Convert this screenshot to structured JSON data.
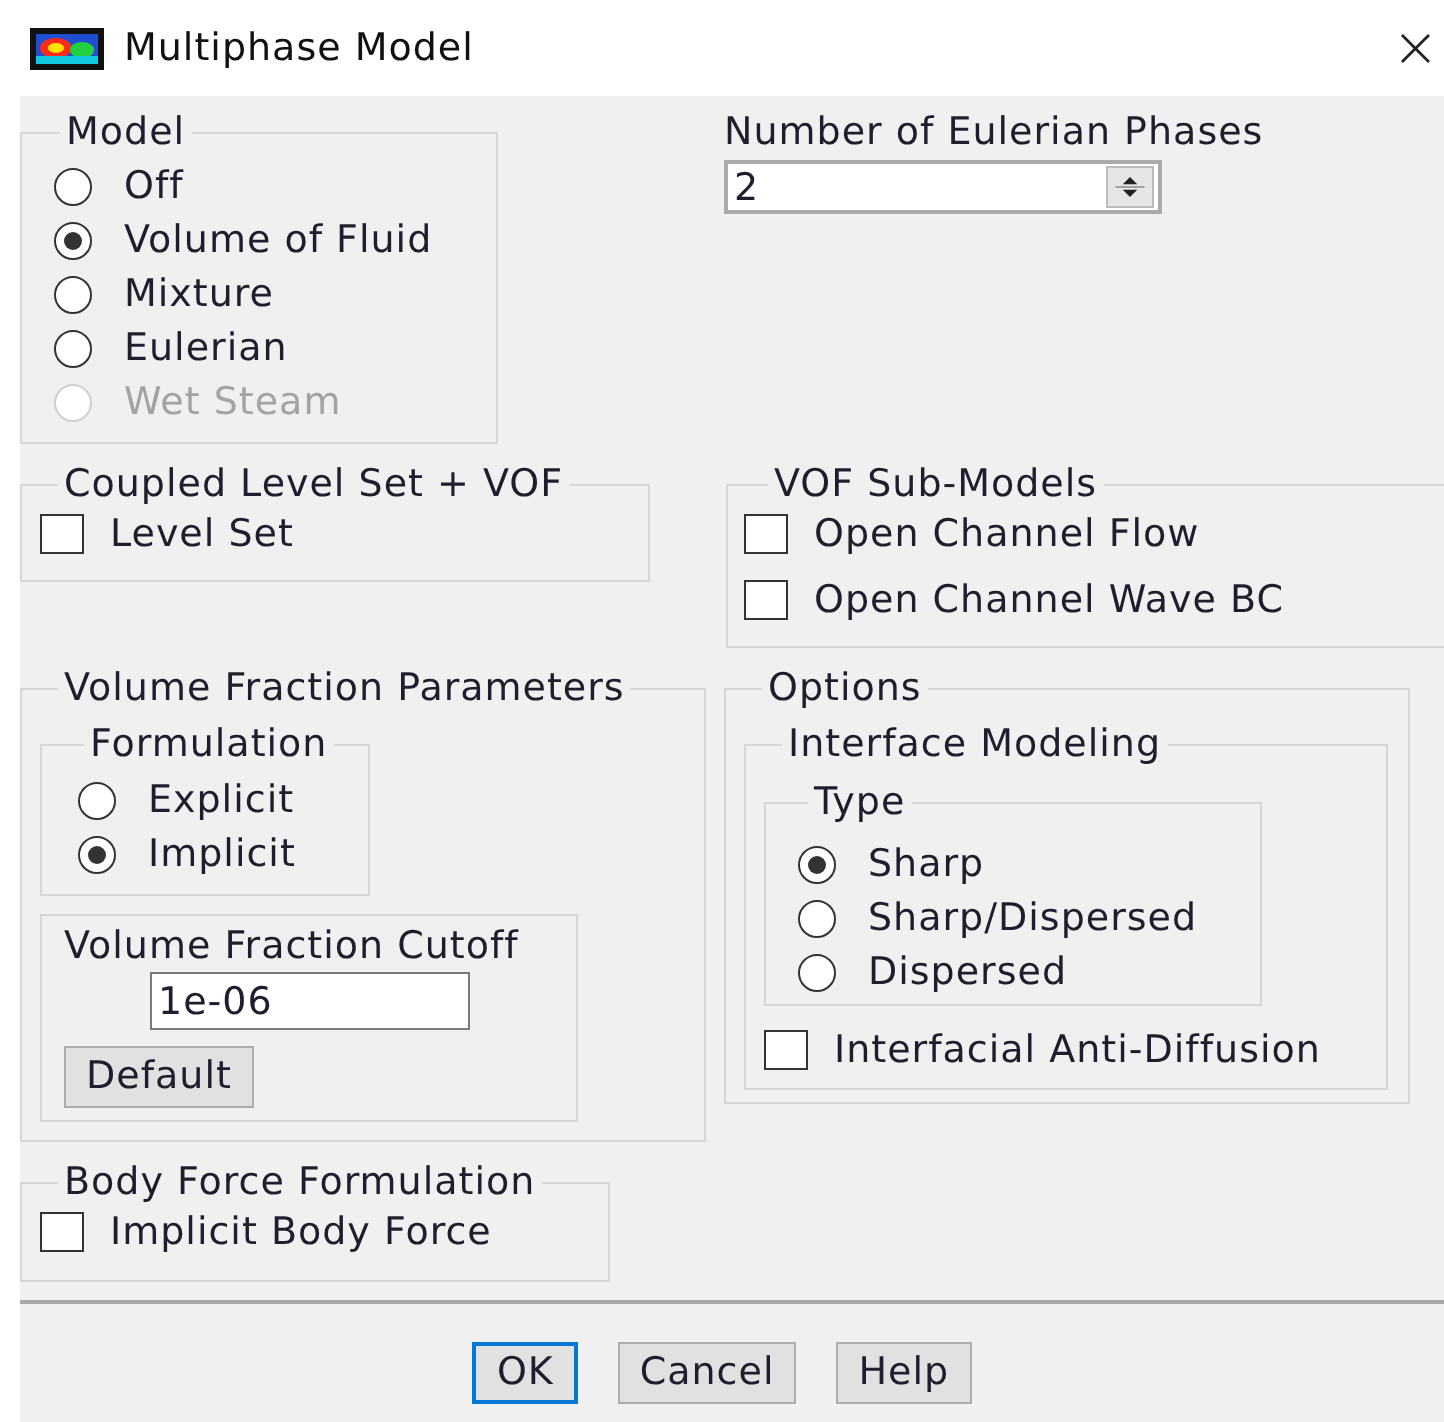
{
  "window": {
    "title": "Multiphase Model",
    "close": "×"
  },
  "model": {
    "label": "Model",
    "options": [
      {
        "label": "Off",
        "selected": false,
        "disabled": false
      },
      {
        "label": "Volume of Fluid",
        "selected": true,
        "disabled": false
      },
      {
        "label": "Mixture",
        "selected": false,
        "disabled": false
      },
      {
        "label": "Eulerian",
        "selected": false,
        "disabled": false
      },
      {
        "label": "Wet Steam",
        "selected": false,
        "disabled": true
      }
    ]
  },
  "eulerian_phases": {
    "label": "Number of Eulerian Phases",
    "value": "2"
  },
  "coupled_level_set": {
    "label": "Coupled Level Set + VOF",
    "options": [
      {
        "label": "Level Set",
        "checked": false
      }
    ]
  },
  "vof_sub_models": {
    "label": "VOF Sub-Models",
    "options": [
      {
        "label": "Open Channel Flow",
        "checked": false
      },
      {
        "label": "Open Channel Wave BC",
        "checked": false
      }
    ]
  },
  "volume_fraction_parameters": {
    "label": "Volume Fraction Parameters",
    "formulation": {
      "label": "Formulation",
      "options": [
        {
          "label": "Explicit",
          "selected": false
        },
        {
          "label": "Implicit",
          "selected": true
        }
      ]
    },
    "cutoff": {
      "label": "Volume Fraction Cutoff",
      "value": "1e-06",
      "button": "Default"
    }
  },
  "options": {
    "label": "Options",
    "interface_modeling": {
      "label": "Interface Modeling",
      "type": {
        "label": "Type",
        "options": [
          {
            "label": "Sharp",
            "selected": true
          },
          {
            "label": "Sharp/Dispersed",
            "selected": false
          },
          {
            "label": "Dispersed",
            "selected": false
          }
        ]
      },
      "options": [
        {
          "label": "Interfacial Anti-Diffusion",
          "checked": false
        }
      ]
    }
  },
  "body_force": {
    "label": "Body Force Formulation",
    "options": [
      {
        "label": "Implicit Body Force",
        "checked": false
      }
    ]
  },
  "buttons": [
    {
      "label": "OK",
      "default": true
    },
    {
      "label": "Cancel",
      "default": false
    },
    {
      "label": "Help",
      "default": false
    }
  ]
}
